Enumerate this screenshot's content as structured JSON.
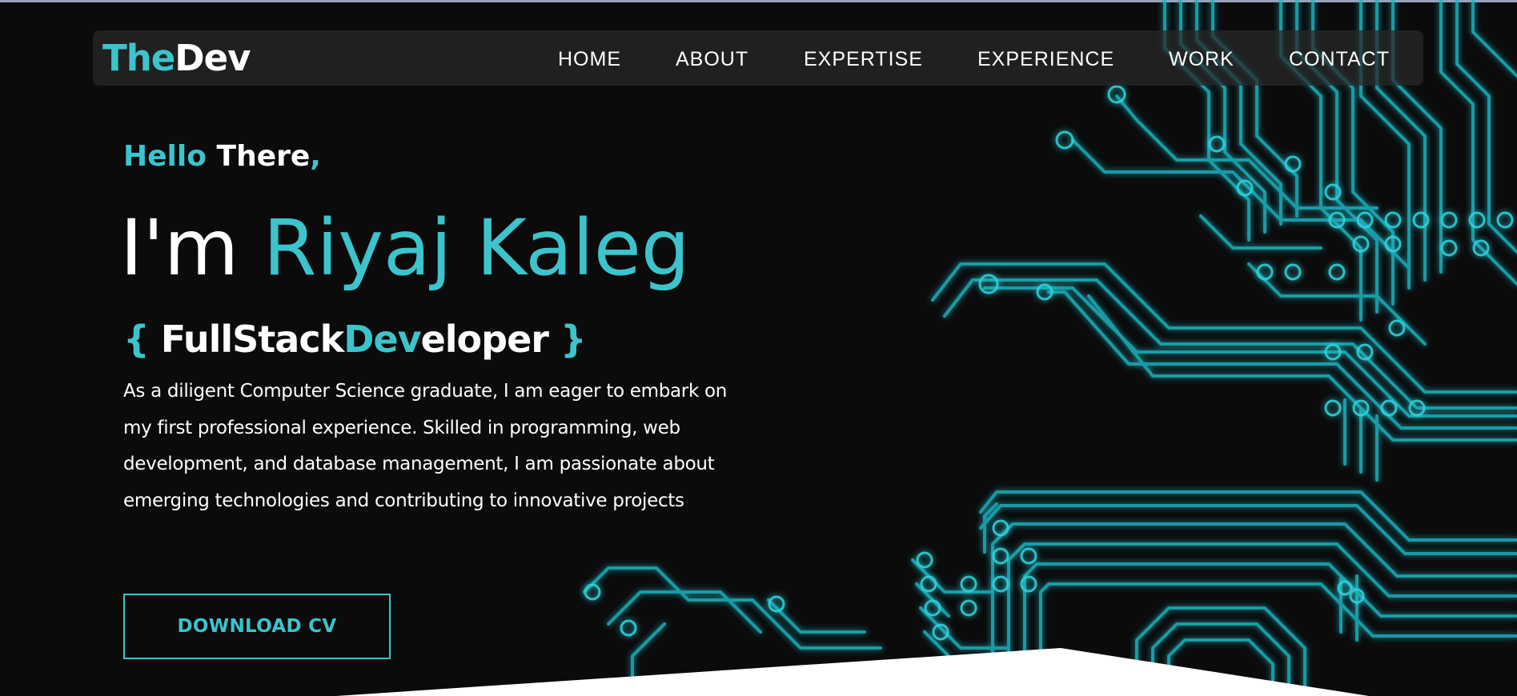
{
  "logo": {
    "part1": "The",
    "part2": "Dev"
  },
  "nav": {
    "items": [
      "HOME",
      "ABOUT",
      "EXPERTISE",
      "EXPERIENCE",
      "WORK",
      "CONTACT"
    ]
  },
  "hero": {
    "greeting_hello": "Hello",
    "greeting_there": "There",
    "greeting_comma": ",",
    "name_prefix": "I'm",
    "name": "Riyaj Kaleg",
    "role_open": "{",
    "role_part1": "FullStack",
    "role_part2": "Dev",
    "role_part3": "eloper",
    "role_close": "}",
    "description": "As a diligent Computer Science graduate, I am eager to embark on my first professional experience. Skilled in programming, web development, and database management, I am passionate about emerging technologies and contributing to innovative projects",
    "cta_label": "DOWNLOAD CV"
  },
  "colors": {
    "accent": "#3cc4cc",
    "background": "#0b0b0c",
    "text": "#ffffff",
    "circuit": "#1fb5c2"
  }
}
